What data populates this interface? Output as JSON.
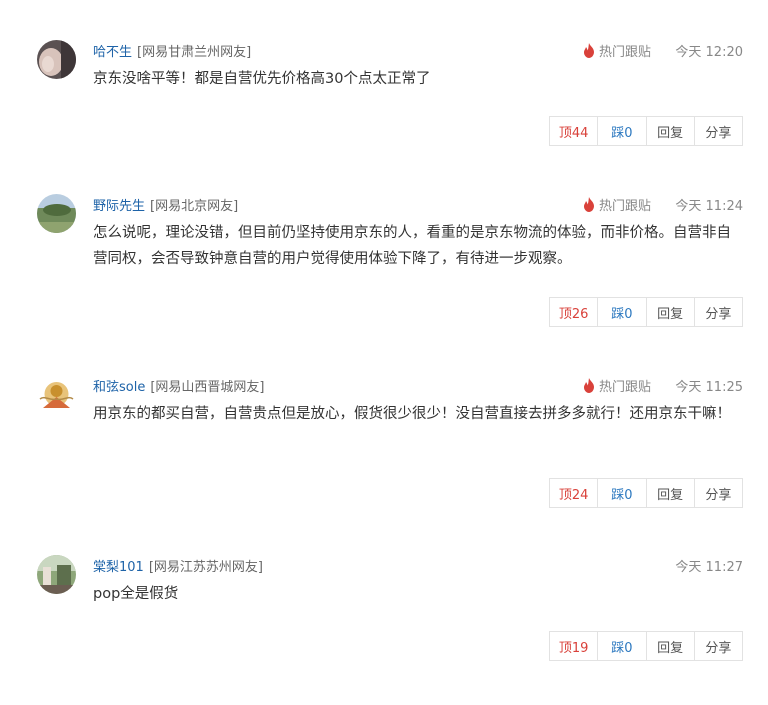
{
  "labels": {
    "hot_follow": "热门跟贴",
    "reply": "回复",
    "share": "分享"
  },
  "colors": {
    "username": "#1e63a8",
    "up_vote": "#d9413a",
    "down_vote": "#2d79c0",
    "flame": "#d9413a"
  },
  "comments": [
    {
      "username": "哈不生",
      "location": "[网易甘肃兰州网友]",
      "hot": true,
      "time": "今天 12:20",
      "content": "京东没啥平等！都是自营优先价格高30个点太正常了",
      "up": "顶44",
      "down": "踩0"
    },
    {
      "username": "野际先生",
      "location": "[网易北京网友]",
      "hot": true,
      "time": "今天 11:24",
      "content": "怎么说呢，理论没错，但目前仍坚持使用京东的人，看重的是京东物流的体验，而非价格。自营非自营同权，会否导致钟意自营的用户觉得使用体验下降了，有待进一步观察。",
      "up": "顶26",
      "down": "踩0"
    },
    {
      "username": "和弦sole",
      "location": "[网易山西晋城网友]",
      "hot": true,
      "time": "今天 11:25",
      "content": "用京东的都买自营，自营贵点但是放心，假货很少很少！没自营直接去拼多多就行！还用京东干嘛！",
      "up": "顶24",
      "down": "踩0"
    },
    {
      "username": "棠梨101",
      "location": "[网易江苏苏州网友]",
      "hot": false,
      "time": "今天 11:27",
      "content": "pop全是假货",
      "up": "顶19",
      "down": "踩0"
    }
  ]
}
